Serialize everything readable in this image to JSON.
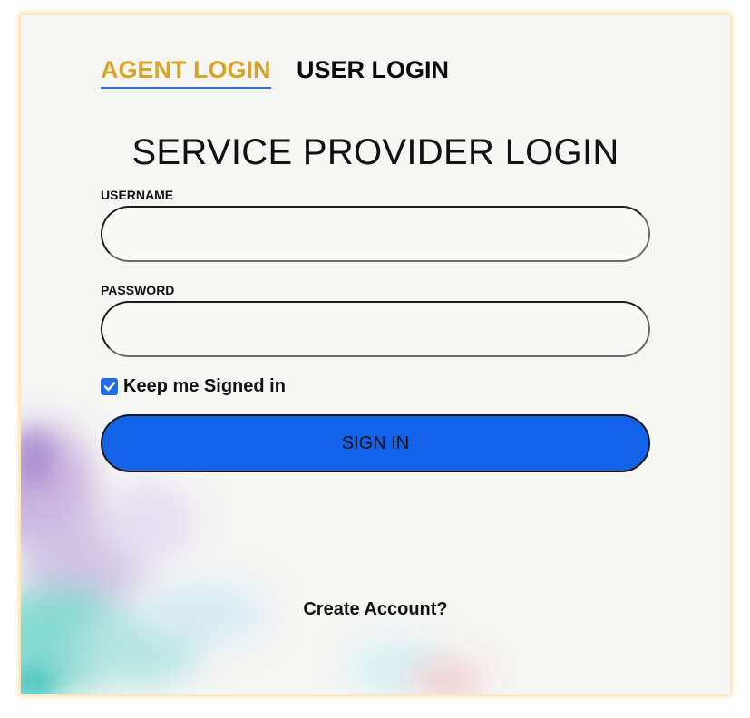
{
  "tabs": {
    "agent_login": "AGENT LOGIN",
    "user_login": "USER LOGIN",
    "active": "agent_login"
  },
  "form": {
    "title": "SERVICE PROVIDER LOGIN",
    "username_label": "USERNAME",
    "username_value": "",
    "password_label": "PASSWORD",
    "password_value": "",
    "keep_signed_in_label": "Keep me Signed in",
    "keep_signed_in_checked": true,
    "sign_in_label": "SIGN IN"
  },
  "footer": {
    "create_account": "Create Account?"
  },
  "colors": {
    "active_tab": "#d6a42a",
    "tab_underline": "#2f6fd6",
    "primary_button": "#1462ea",
    "card_glow": "#f0be50"
  },
  "icons": {
    "checkbox": "checkmark-icon"
  }
}
